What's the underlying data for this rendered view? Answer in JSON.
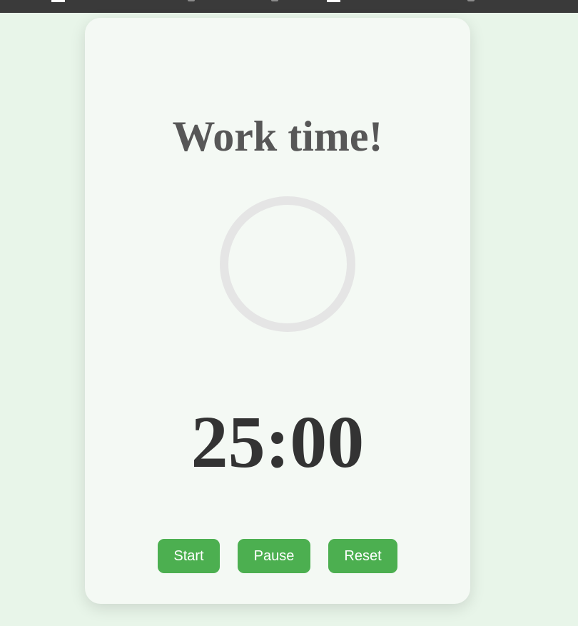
{
  "timer": {
    "title": "Work time!",
    "time_display": "25:00",
    "progress": 0
  },
  "controls": {
    "start_label": "Start",
    "pause_label": "Pause",
    "reset_label": "Reset"
  },
  "colors": {
    "background": "#e8f5e9",
    "card": "#f4f9f4",
    "accent": "#4caf50",
    "ring_track": "#e5e5e5",
    "title_text": "#575757",
    "timer_text": "#333333"
  }
}
